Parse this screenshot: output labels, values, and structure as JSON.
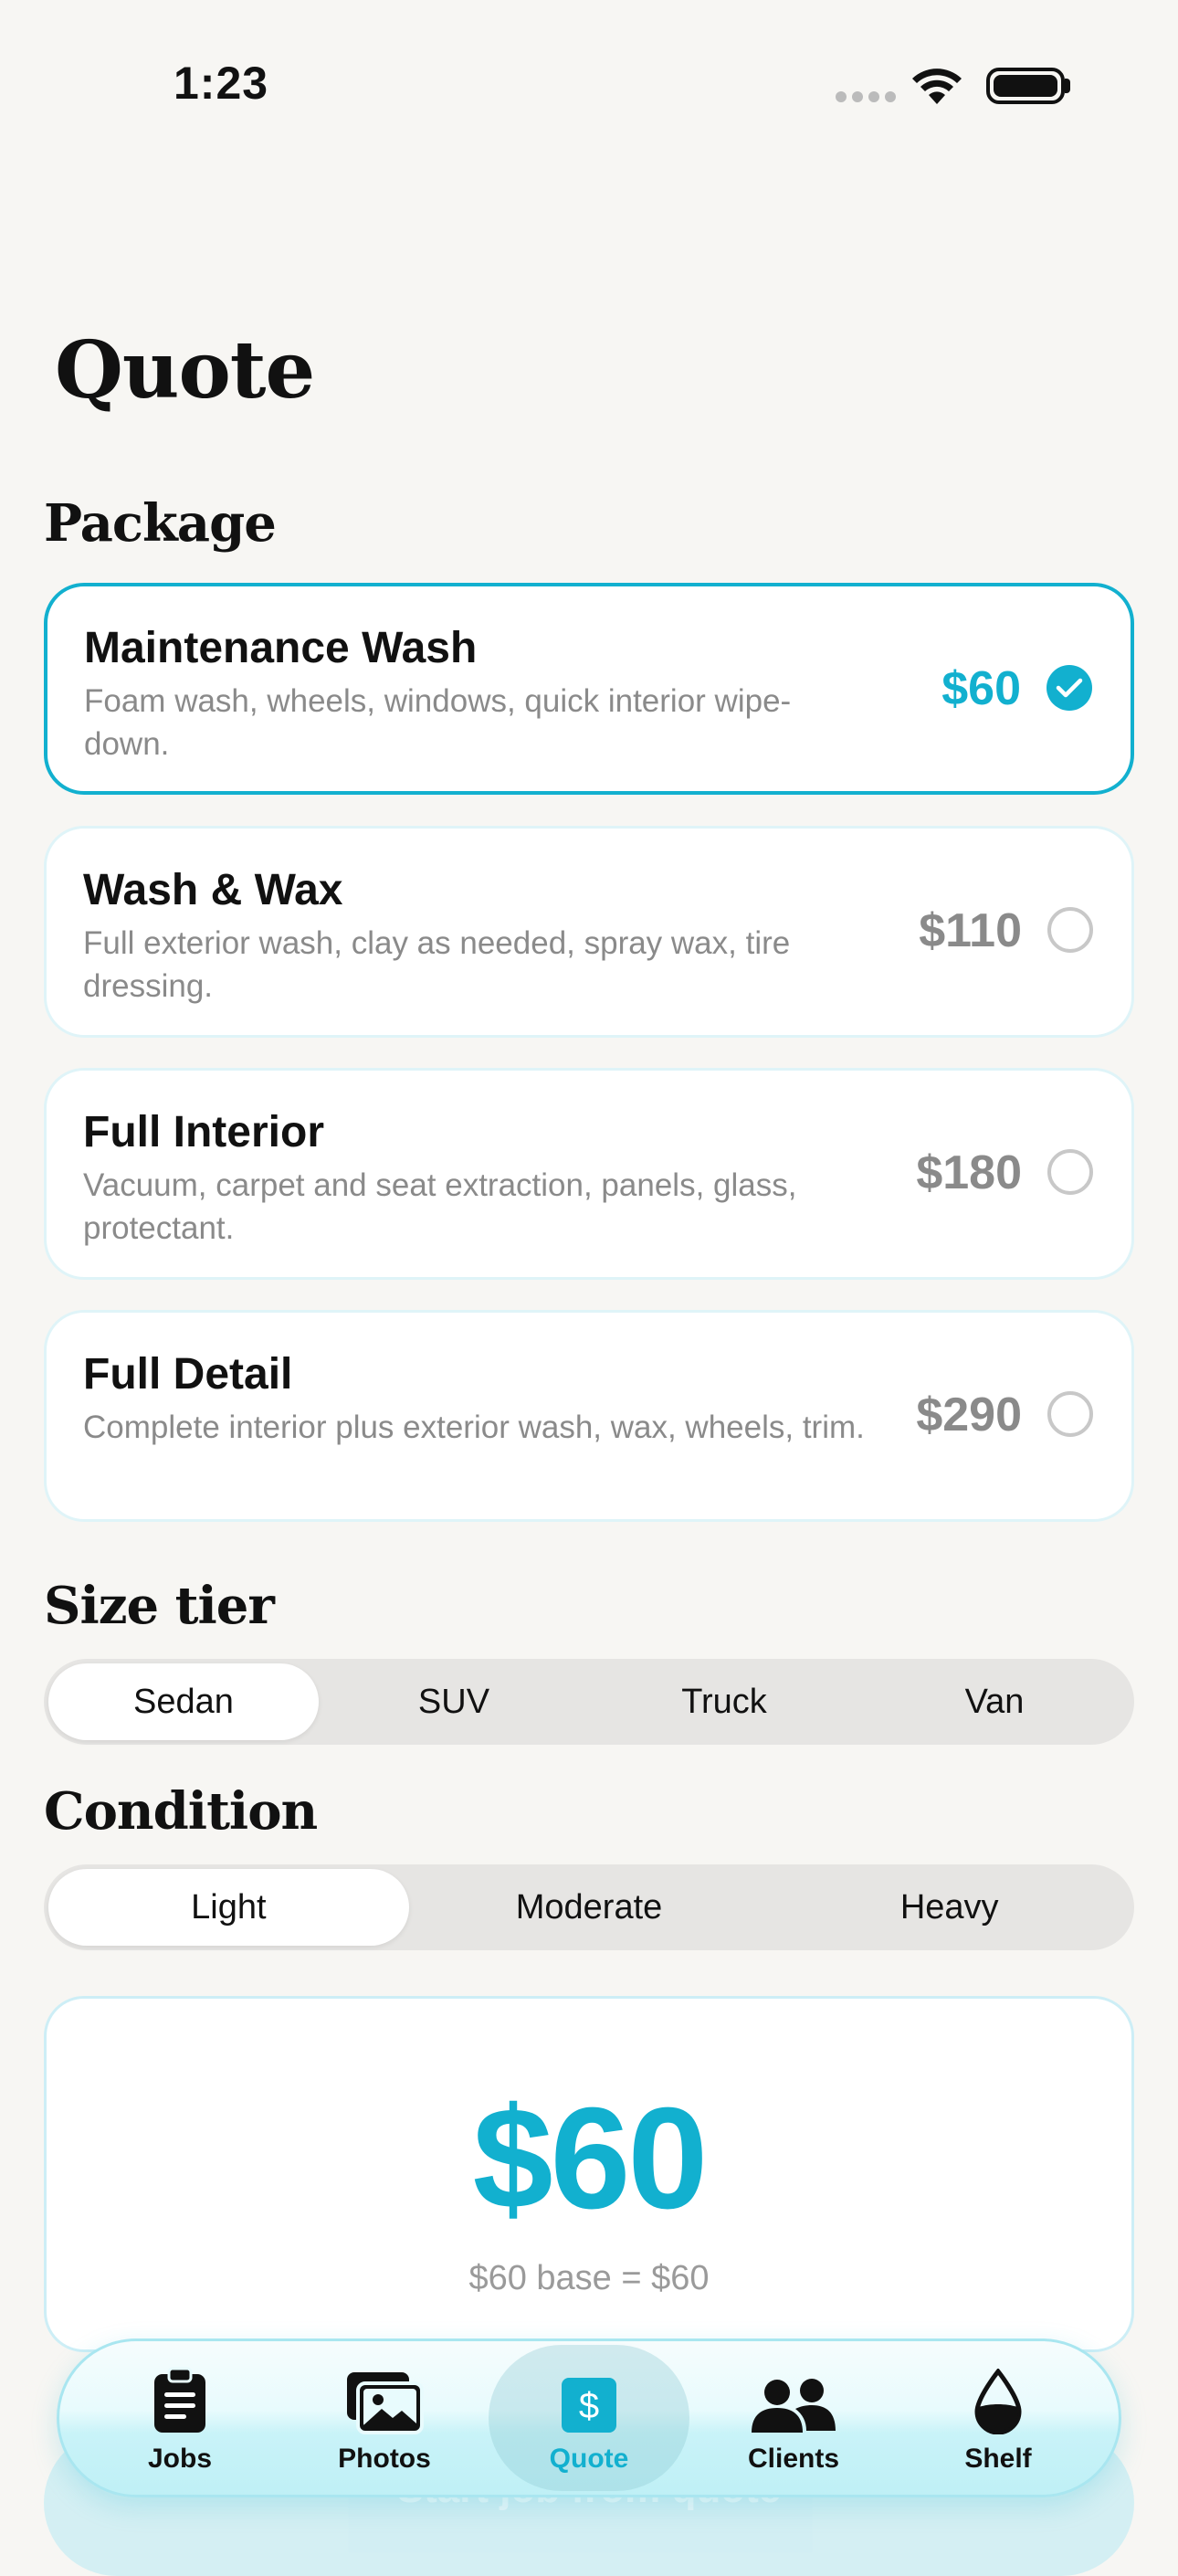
{
  "status_bar": {
    "time": "1:23"
  },
  "page": {
    "title": "Quote"
  },
  "package_section": {
    "title": "Package",
    "packages": [
      {
        "name": "Maintenance Wash",
        "description": "Foam wash, wheels, windows, quick interior wipe-down.",
        "price": "$60",
        "selected": true
      },
      {
        "name": "Wash & Wax",
        "description": "Full exterior wash, clay as needed, spray wax, tire dressing.",
        "price": "$110",
        "selected": false
      },
      {
        "name": "Full Interior",
        "description": "Vacuum, carpet and seat extraction, panels, glass, protectant.",
        "price": "$180",
        "selected": false
      },
      {
        "name": "Full Detail",
        "description": "Complete interior plus exterior wash, wax, wheels, trim.",
        "price": "$290",
        "selected": false
      }
    ]
  },
  "size_section": {
    "title": "Size tier",
    "options": [
      "Sedan",
      "SUV",
      "Truck",
      "Van"
    ],
    "selected": "Sedan"
  },
  "condition_section": {
    "title": "Condition",
    "options": [
      "Light",
      "Moderate",
      "Heavy"
    ],
    "selected": "Light"
  },
  "total": {
    "amount": "$60",
    "breakdown": "$60 base = $60"
  },
  "cta": {
    "label": "Start job from quote"
  },
  "tab_bar": {
    "tabs": [
      {
        "label": "Jobs",
        "icon": "clipboard-icon"
      },
      {
        "label": "Photos",
        "icon": "photos-icon"
      },
      {
        "label": "Quote",
        "icon": "dollar-sign-icon",
        "active": true
      },
      {
        "label": "Clients",
        "icon": "people-icon"
      },
      {
        "label": "Shelf",
        "icon": "droplet-icon"
      }
    ]
  },
  "colors": {
    "accent": "#12b0cf",
    "background": "#f7f6f3",
    "muted_text": "#8a8a8a"
  }
}
